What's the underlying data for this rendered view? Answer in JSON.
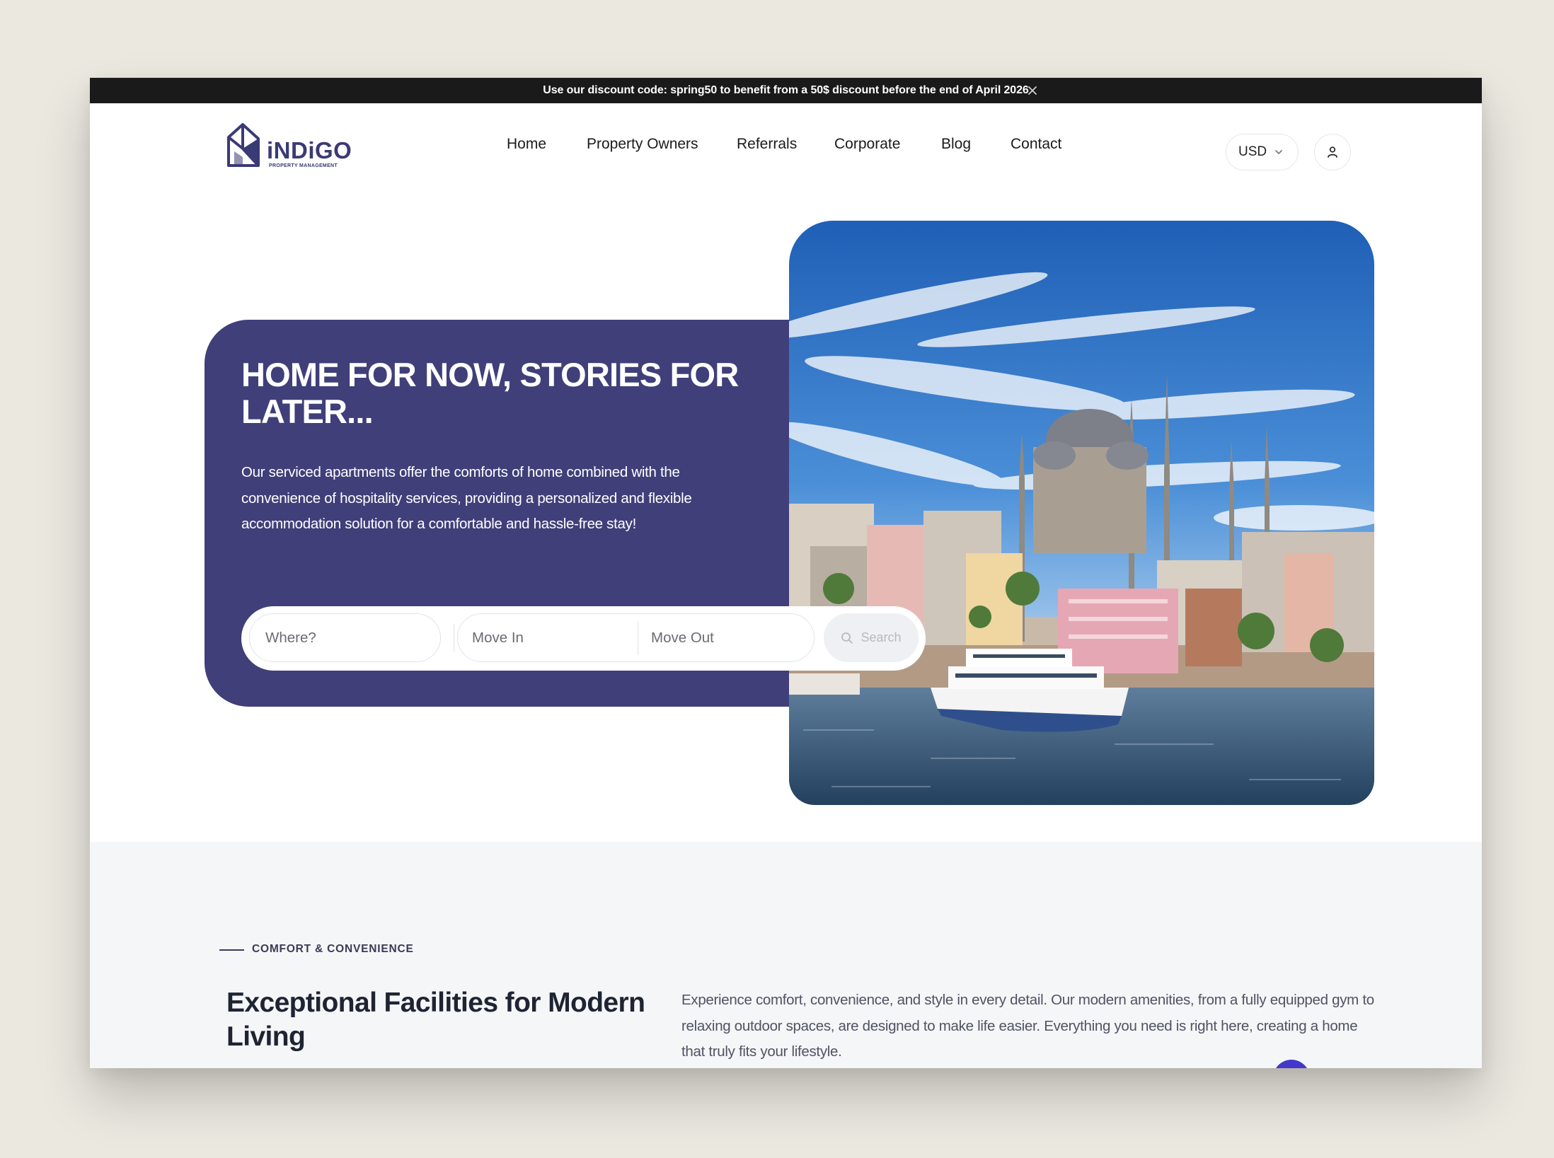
{
  "announcement": {
    "text": "Use our discount code: spring50 to benefit from a 50$ discount before the end of April 2026",
    "close_icon": "close-icon"
  },
  "brand": {
    "name": "iNDiGO",
    "tagline": "PROPERTY MANAGEMENT",
    "color": "#3a3a76"
  },
  "nav": {
    "items": [
      {
        "label": "Home"
      },
      {
        "label": "Property Owners"
      },
      {
        "label": "Referrals"
      },
      {
        "label": "Corporate"
      },
      {
        "label": "Blog"
      },
      {
        "label": "Contact"
      }
    ]
  },
  "header": {
    "currency": "USD",
    "currency_icon": "chevron-down-icon",
    "user_icon": "user-icon"
  },
  "hero": {
    "title": "HOME FOR NOW, STORIES FOR LATER...",
    "description": "Our serviced apartments offer the comforts of home combined with the convenience of hospitality services, providing a personalized and flexible accommodation solution for a comfortable and hassle-free stay!",
    "accent_color": "#403f7a",
    "image_icon": "istanbul-mosque-skyline-image"
  },
  "search": {
    "where_placeholder": "Where?",
    "move_in_placeholder": "Move In",
    "move_out_placeholder": "Move Out",
    "button_label": "Search",
    "button_icon": "search-icon"
  },
  "facilities": {
    "eyebrow": "COMFORT & CONVENIENCE",
    "title": "Exceptional Facilities for Modern Living",
    "description": "Experience comfort, convenience, and style in every detail. Our modern amenities, from a fully equipped gym to relaxing outdoor spaces, are designed to make life easier. Everything you need is right here, creating a home that truly fits your lifestyle."
  },
  "colors": {
    "announcement_bg": "#1a1a1a",
    "section_bg": "#f5f6f8",
    "fab": "#4338ca"
  }
}
